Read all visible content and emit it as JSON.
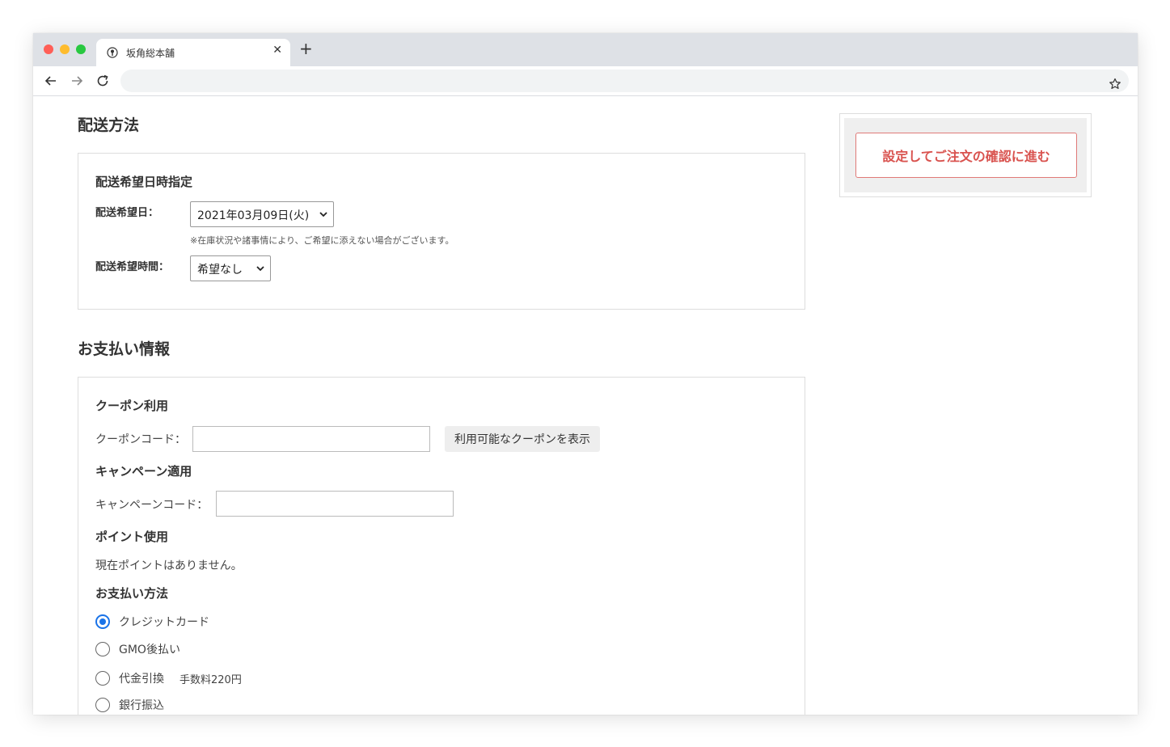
{
  "browser": {
    "tab_title": "坂角総本舗",
    "url": ""
  },
  "shipping": {
    "title": "配送方法",
    "section_title": "配送希望日時指定",
    "date_label": "配送希望日：",
    "date_value": "2021年03月09日(火)",
    "date_note": "※在庫状況や諸事情により、ご希望に添えない場合がございます。",
    "time_label": "配送希望時間：",
    "time_value": "希望なし"
  },
  "payment": {
    "title": "お支払い情報",
    "coupon": {
      "title": "クーポン利用",
      "label": "クーポンコード：",
      "value": "",
      "show_button": "利用可能なクーポンを表示"
    },
    "campaign": {
      "title": "キャンペーン適用",
      "label": "キャンペーンコード：",
      "value": ""
    },
    "points": {
      "title": "ポイント使用",
      "text": "現在ポイントはありません。"
    },
    "method": {
      "title": "お支払い方法",
      "options": [
        {
          "label": "クレジットカード",
          "selected": true
        },
        {
          "label": "GMO後払い",
          "selected": false
        },
        {
          "label": "代金引換",
          "fee": "手数料220円",
          "selected": false
        },
        {
          "label": "銀行振込",
          "selected": false
        }
      ]
    }
  },
  "sidebar": {
    "proceed_button": "設定してご注文の確認に進む"
  },
  "colors": {
    "accent_red": "#d9534f",
    "radio_blue": "#1a73e8",
    "tabbar": "#dee1e6"
  }
}
